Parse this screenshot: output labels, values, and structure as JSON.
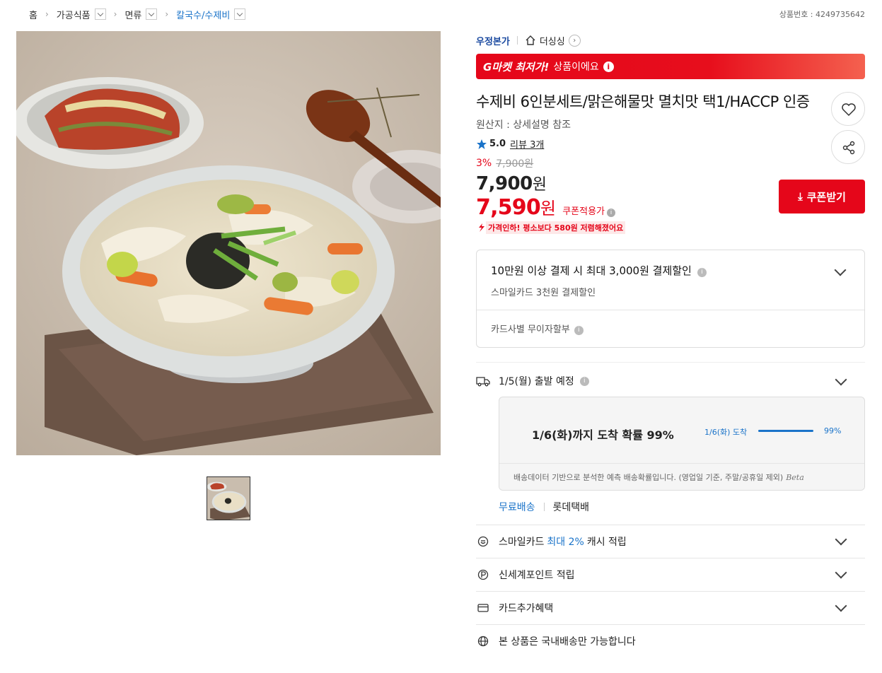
{
  "breadcrumb": {
    "home": "홈",
    "level1": "가공식품",
    "level2": "면류",
    "level3": "칼국수/수제비"
  },
  "product_number": "상품번호 : 4249735642",
  "seller": {
    "name": "우정본가",
    "store": "더싱싱"
  },
  "lowest_banner": {
    "bold": "G마켓 최저가!",
    "text": "상품이에요"
  },
  "title": "수제비 6인분세트/맑은해물맛 멸치맛 택1/HACCP 인증",
  "origin": "원산지 : 상세설명 참조",
  "rating": {
    "score": "5.0",
    "review": "리뷰 3개"
  },
  "price": {
    "discount_rate": "3%",
    "original": "7,900원",
    "sale_number": "7,900",
    "sale_unit": "원",
    "coupon_number": "7,590",
    "coupon_unit": "원",
    "coupon_label": "쿠폰적용가",
    "drop_text": "가격인하! 평소보다 580원 저렴해졌어요"
  },
  "coupon_button": "쿠폰받기",
  "payment": {
    "title": "10만원 이상 결제 시 최대 3,000원 결제할인",
    "sub": "스마일카드 3천원 결제할인",
    "installment": "카드사별 무이자할부"
  },
  "shipping": {
    "departure": "1/5(월) 출발 예정",
    "prob_title": "1/6(화)까지 도착 확률 99%",
    "prob_date": "1/6(화) 도착",
    "prob_pct_label": "99%",
    "prob_pct": 99,
    "note": "배송데이터 기반으로 분석한 예측 배송확률입니다. (영업일 기준, 주말/공휴일 제외)",
    "beta": "Beta",
    "free": "무료배송",
    "carrier": "롯데택배"
  },
  "benefits": {
    "smile_pre": "스마일카드",
    "smile_hl": "최대 2%",
    "smile_post": "캐시 적립",
    "ssg_point": "신세계포인트 적립",
    "card_extra": "카드추가혜택",
    "domestic": "본 상품은 국내배송만 가능합니다"
  },
  "colors": {
    "brand_red": "#e5061a",
    "link_blue": "#1a73c9",
    "seller_blue": "#1b4aa0"
  },
  "icons": [
    "chevron-right-icon",
    "chevron-down-icon",
    "home-icon",
    "info-icon",
    "heart-icon",
    "share-icon",
    "star-icon",
    "arrow-down-icon",
    "truck-icon",
    "smile-icon",
    "point-icon",
    "card-icon",
    "globe-icon"
  ]
}
